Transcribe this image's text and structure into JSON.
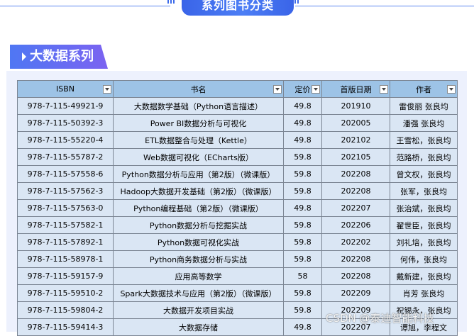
{
  "banner": {
    "title": "系列图书分类"
  },
  "section": {
    "title": "大数据系列"
  },
  "table": {
    "columns": [
      "ISBN",
      "书名",
      "定价",
      "首版日期",
      "作者"
    ],
    "rows": [
      [
        "978-7-115-49921-9",
        "大数据数学基础（Python语言描述）",
        "49.8",
        "201910",
        "雷俊丽 张良均"
      ],
      [
        "978-7-115-50392-3",
        "Power BI数据分析与可视化",
        "49.8",
        "202005",
        "潘强 张良均"
      ],
      [
        "978-7-115-55220-4",
        "ETL数据整合与处理（Kettle）",
        "49.8",
        "202102",
        "王雪松，张良均"
      ],
      [
        "978-7-115-55787-2",
        "Web数据可视化（ECharts版）",
        "59.8",
        "202105",
        "范路桥，张良均"
      ],
      [
        "978-7-115-57558-6",
        "Python数据分析与应用（第2版）（微课版）",
        "59.8",
        "202208",
        "曾文权，张良均"
      ],
      [
        "978-7-115-57562-3",
        "Hadoop大数据开发基础（第2版）（微课版）",
        "59.8",
        "202208",
        "张军，张良均"
      ],
      [
        "978-7-115-57563-0",
        "Python编程基础（第2版）（微课版）",
        "49.8",
        "202207",
        "张治斌，张良均"
      ],
      [
        "978-7-115-57582-1",
        "Python数据分析与挖掘实战",
        "59.8",
        "202206",
        "翟世臣，张良均"
      ],
      [
        "978-7-115-57892-1",
        "Python数据可视化实战",
        "59.8",
        "202202",
        "刘礼培，张良均"
      ],
      [
        "978-7-115-58978-1",
        "Python商务数据分析与实战",
        "59.8",
        "202208",
        "何伟，张良均"
      ],
      [
        "978-7-115-59157-9",
        "应用高等数学",
        "58",
        "202208",
        "戴新建，张良均"
      ],
      [
        "978-7-115-59510-2",
        "Spark大数据技术与应用（第2版）（微课版）",
        "59.8",
        "202209",
        "肖芳 张良均"
      ],
      [
        "978-7-115-59804-2",
        "大数据开发项目实战",
        "59.8",
        "202209",
        "祝锡永，张良均"
      ],
      [
        "978-7-115-59414-3",
        "大数据存储",
        "49.8",
        "202207",
        "谭旭，李程文"
      ]
    ]
  },
  "watermark": "CSDN @泰迪智能科技"
}
